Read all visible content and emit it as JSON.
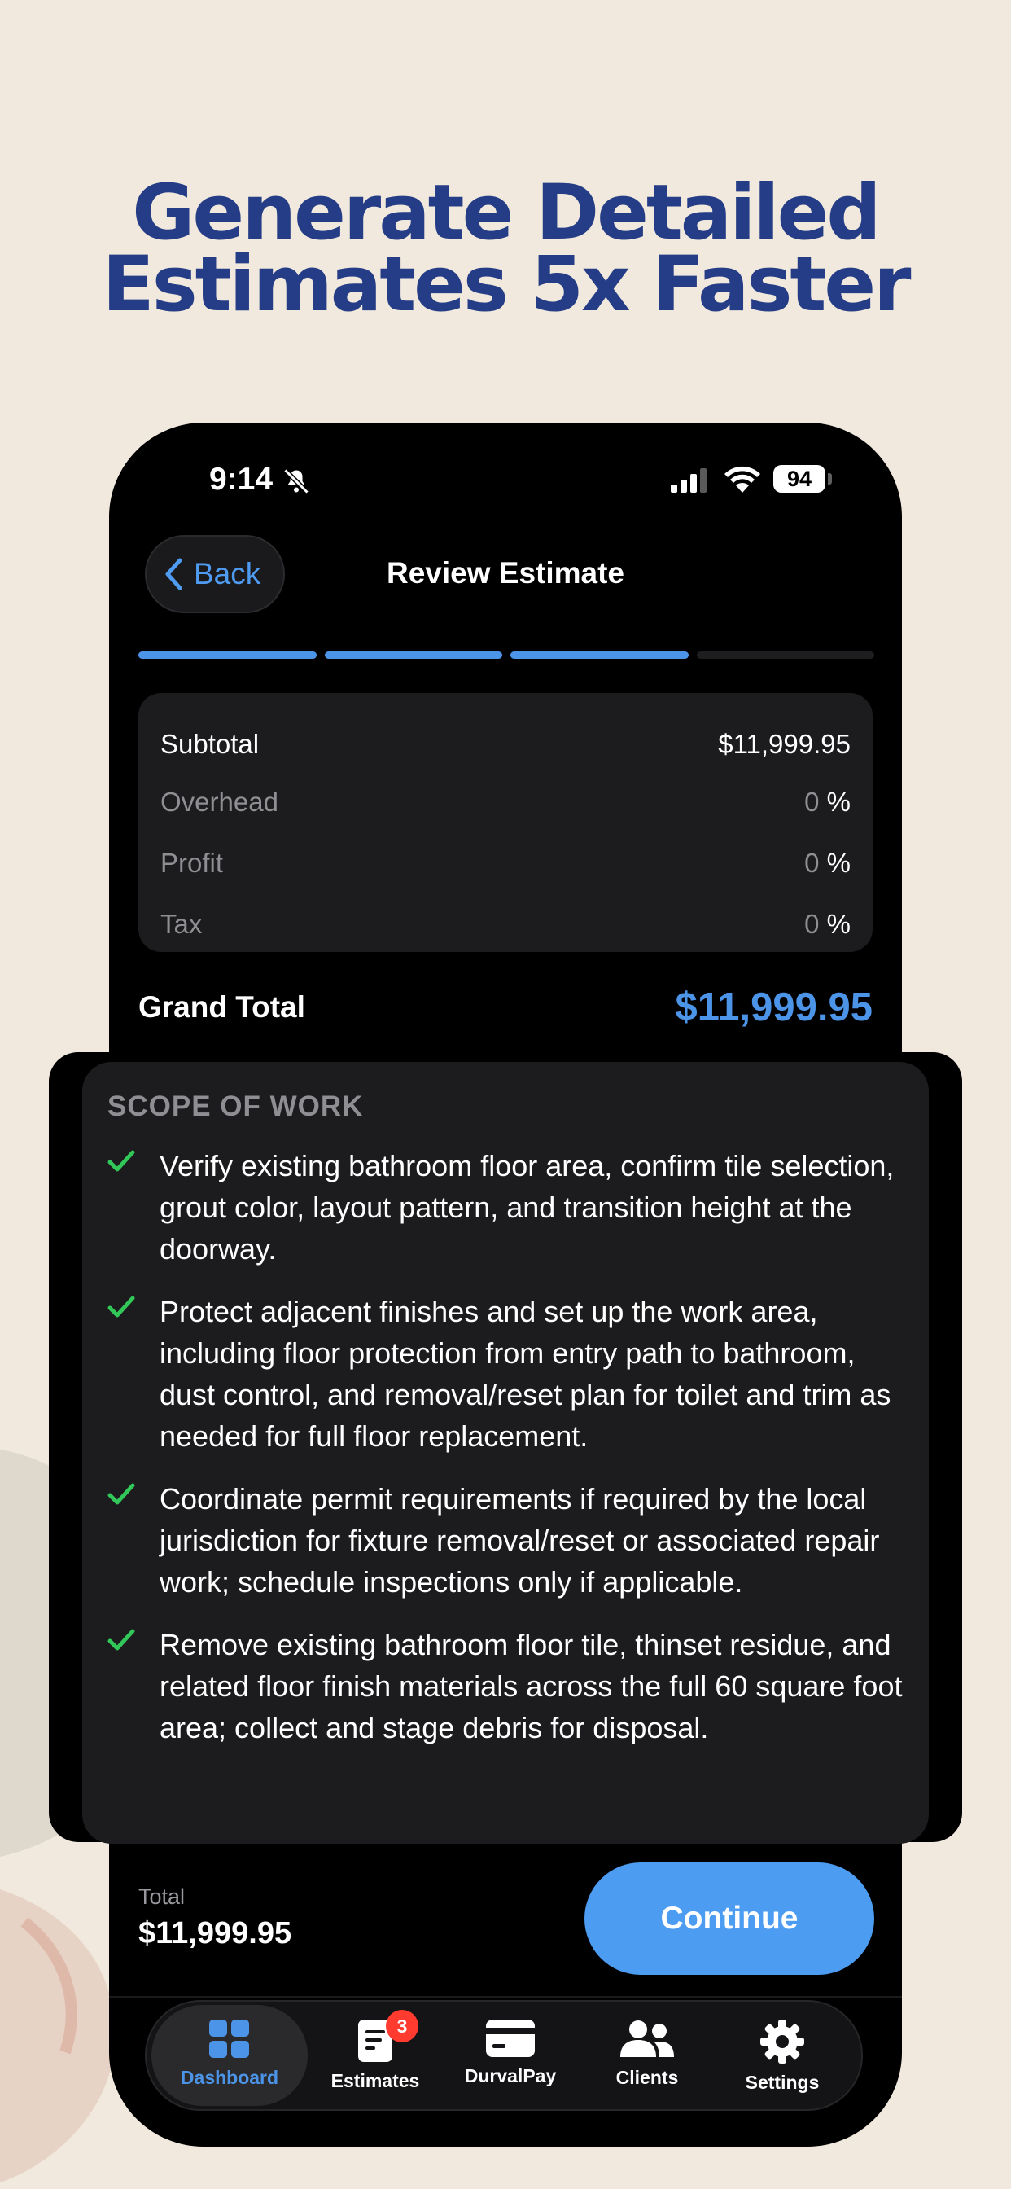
{
  "headline": {
    "line1": "Generate Detailed",
    "line2": "Estimates 5x Faster"
  },
  "status_bar": {
    "time": "9:14",
    "battery": "94"
  },
  "nav": {
    "back_label": "Back",
    "title": "Review Estimate"
  },
  "progress": {
    "steps_total": 4,
    "steps_done": 3
  },
  "summary": {
    "subtotal_label": "Subtotal",
    "subtotal_value": "$11,999.95",
    "overhead_label": "Overhead",
    "overhead_value": "0",
    "profit_label": "Profit",
    "profit_value": "0",
    "tax_label": "Tax",
    "tax_value": "0",
    "pct_symbol": "%"
  },
  "grand_total": {
    "label": "Grand Total",
    "value": "$11,999.95"
  },
  "scope": {
    "title": "SCOPE OF WORK",
    "items": [
      "Verify existing bathroom floor area, confirm tile selection, grout color, layout pattern, and transition height at the doorway.",
      "Protect adjacent finishes and set up the work area, including floor protection from entry path to bathroom, dust control, and removal/reset plan for toilet and trim as needed for full floor replacement.",
      "Coordinate permit requirements if required by the local jurisdiction for fixture removal/reset or associated repair work; schedule inspections only if applicable.",
      "Remove existing bathroom floor tile, thinset residue, and related floor finish materials across the full 60 square foot area; collect and stage debris for disposal."
    ]
  },
  "footer": {
    "total_label": "Total",
    "total_value": "$11,999.95",
    "continue_label": "Continue"
  },
  "tabs": [
    {
      "label": "Dashboard",
      "icon": "dashboard-icon",
      "active": true
    },
    {
      "label": "Estimates",
      "icon": "document-icon",
      "badge": "3"
    },
    {
      "label": "DurvalPay",
      "icon": "card-icon"
    },
    {
      "label": "Clients",
      "icon": "people-icon"
    },
    {
      "label": "Settings",
      "icon": "gear-icon"
    }
  ],
  "colors": {
    "accent": "#4c94e8",
    "headline": "#253d86",
    "background": "#f1e9dd",
    "check": "#32c759",
    "badge": "#ff3b30"
  }
}
